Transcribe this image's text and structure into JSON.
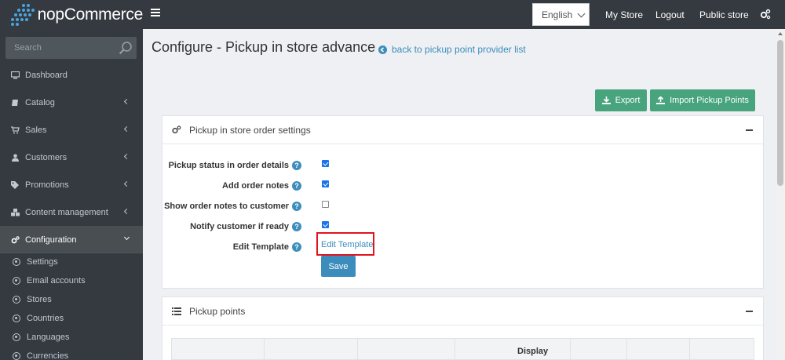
{
  "header": {
    "logo_text": "nopCommerce",
    "language": "English",
    "links": [
      "My Store",
      "Logout",
      "Public store"
    ]
  },
  "sidebar": {
    "search_placeholder": "Search",
    "items": [
      {
        "label": "Dashboard",
        "icon": "monitor-icon"
      },
      {
        "label": "Catalog",
        "icon": "book-icon"
      },
      {
        "label": "Sales",
        "icon": "cart-icon"
      },
      {
        "label": "Customers",
        "icon": "user-icon"
      },
      {
        "label": "Promotions",
        "icon": "tags-icon"
      },
      {
        "label": "Content management",
        "icon": "cubes-icon"
      },
      {
        "label": "Configuration",
        "icon": "gears-icon"
      }
    ],
    "subitems": [
      "Settings",
      "Email accounts",
      "Stores",
      "Countries",
      "Languages",
      "Currencies"
    ]
  },
  "page": {
    "title": "Configure - Pickup in store advance",
    "back_link": "back to pickup point provider list",
    "export_label": "Export",
    "import_label": "Import Pickup Points"
  },
  "settings_card": {
    "title": "Pickup in store order settings",
    "fields": [
      {
        "label": "Pickup status in order details",
        "checked": true
      },
      {
        "label": "Add order notes",
        "checked": true
      },
      {
        "label": "Show order notes to customer",
        "checked": false
      },
      {
        "label": "Notify customer if ready",
        "checked": true
      }
    ],
    "edit_template_label": "Edit Template",
    "edit_template_link": "Edit Template",
    "save_label": "Save"
  },
  "points_card": {
    "title": "Pickup points",
    "table_header": "Display"
  },
  "colors": {
    "sidebar": "#343a40",
    "accent": "#3c8dbc",
    "green": "#47a47d",
    "highlight": "#e0141d"
  }
}
